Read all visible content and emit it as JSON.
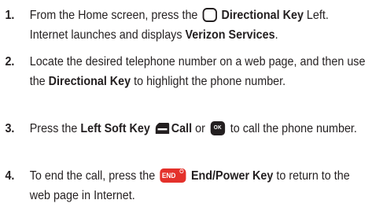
{
  "steps": [
    {
      "number": "1.",
      "parts": {
        "a": "From the Home screen, press the",
        "b": "Directional Key",
        "c": "Left. Internet launches and displays",
        "d": "Verizon Services",
        "e": "."
      }
    },
    {
      "number": "2.",
      "parts": {
        "a": "Locate the desired telephone number on a web page, and then use the",
        "b": "Directional Key",
        "c": "to highlight the phone number."
      }
    },
    {
      "number": "3.",
      "parts": {
        "a": "Press the",
        "b": "Left Soft Key",
        "c": "Call",
        "d": "or",
        "e": "to call the phone number."
      }
    },
    {
      "number": "4.",
      "parts": {
        "a": "To end the call, press the",
        "b": "End/Power Key",
        "c": "to return to the web page in Internet."
      }
    }
  ],
  "keys": {
    "ok_label": "OK",
    "end_label": "END",
    "end_power_symbol": "⏻",
    "end_color": "#e4312b"
  },
  "icons": [
    "directional-key-icon",
    "left-soft-key-icon",
    "ok-key-icon",
    "end-power-key-icon"
  ]
}
